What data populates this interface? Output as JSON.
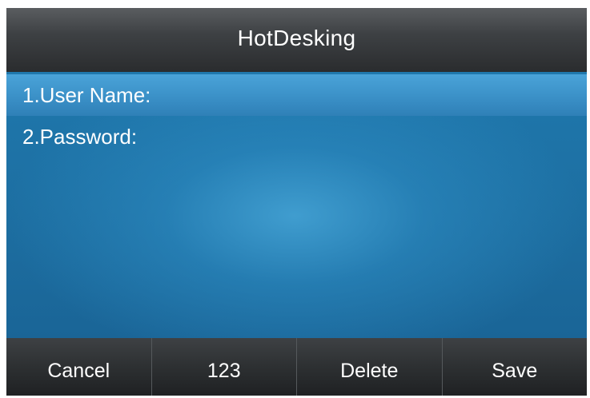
{
  "title": "HotDesking",
  "items": [
    {
      "label": "1.User Name:",
      "selected": true
    },
    {
      "label": "2.Password:",
      "selected": false
    }
  ],
  "softkeys": [
    "Cancel",
    "123",
    "Delete",
    "Save"
  ],
  "colors": {
    "screen_background": "#1e6f9f",
    "selection_highlight": "#3c92c9",
    "bar_background": "#2d3032",
    "text": "#ffffff"
  }
}
